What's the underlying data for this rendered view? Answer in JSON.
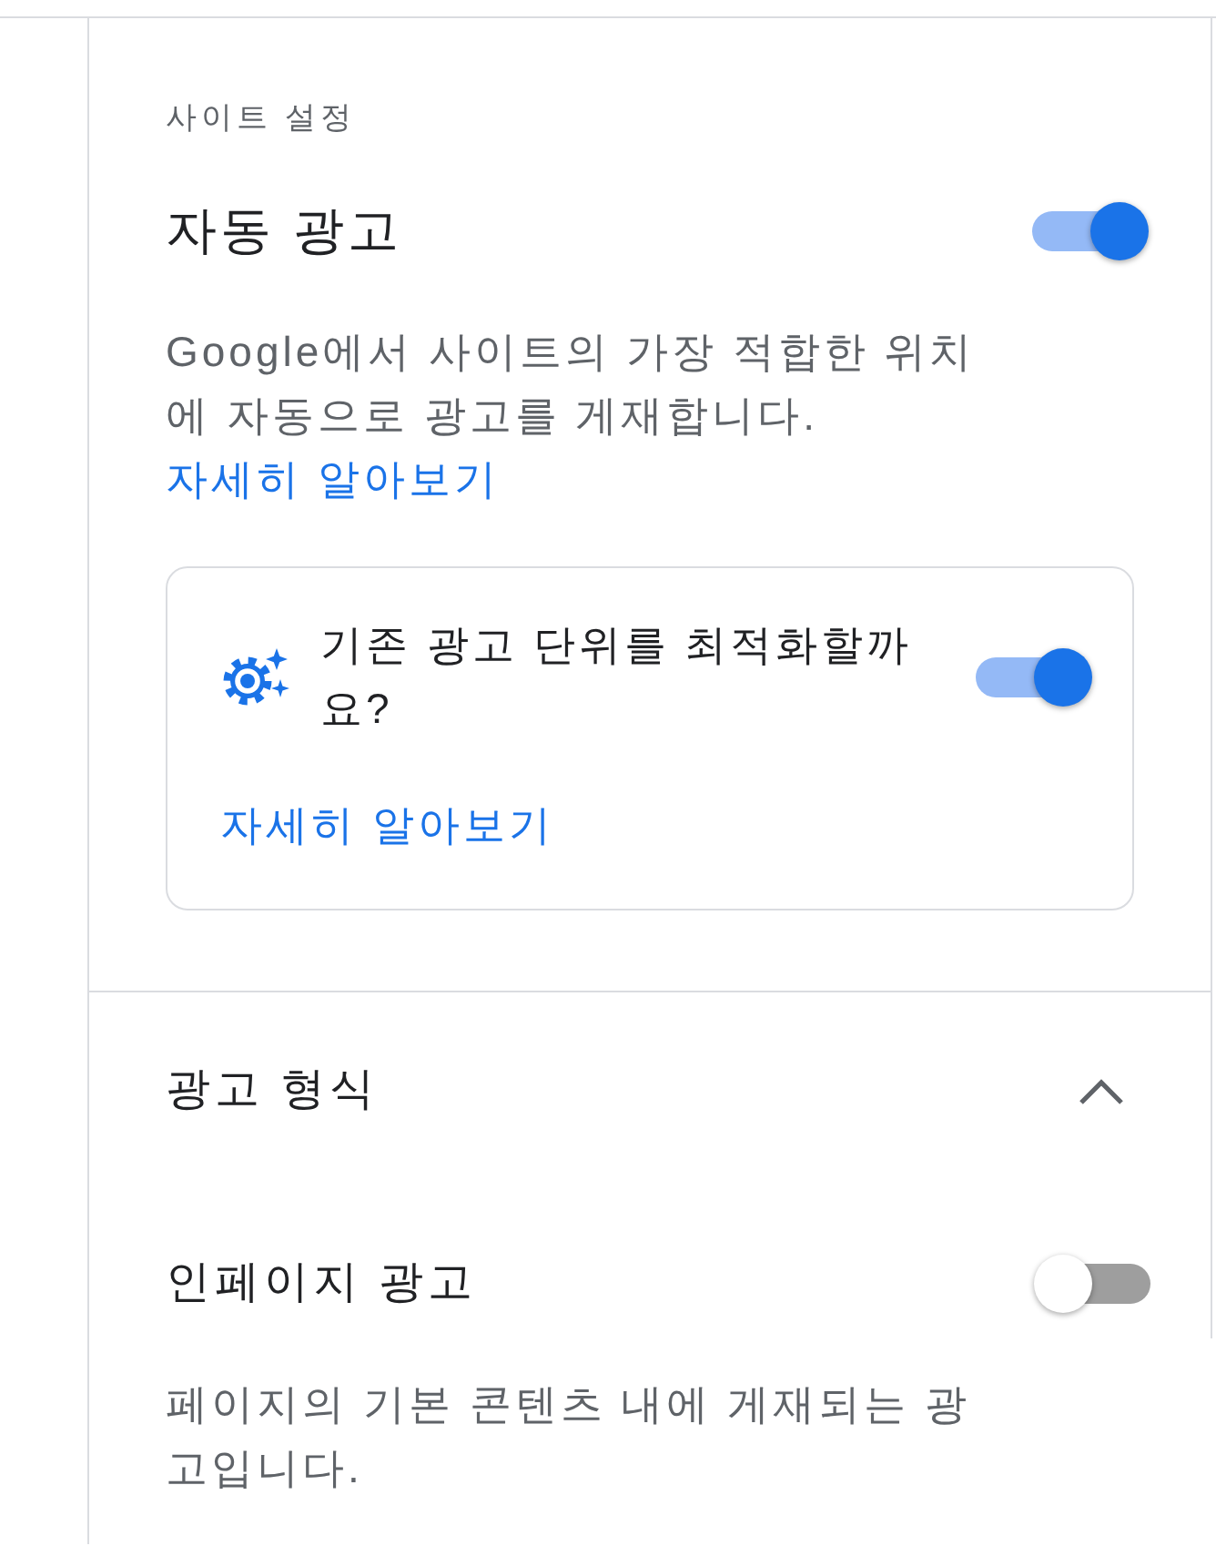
{
  "auto_ads": {
    "eyebrow": "사이트 설정",
    "title": "자동 광고",
    "on": true,
    "description": "Google에서 사이트의 가장 적합한 위치에 자동으로 광고를 게재합니다.",
    "link": "자세히 알아보기"
  },
  "optimize_card": {
    "text": "기존 광고 단위를 최적화할까요?",
    "on": true,
    "link": "자세히 알아보기"
  },
  "ad_formats": {
    "title": "광고 형식",
    "expanded": true,
    "items": [
      {
        "name": "인페이지 광고",
        "on": false,
        "description": "페이지의 기본 콘텐츠 내에 게재되는 광고입니다."
      }
    ]
  }
}
